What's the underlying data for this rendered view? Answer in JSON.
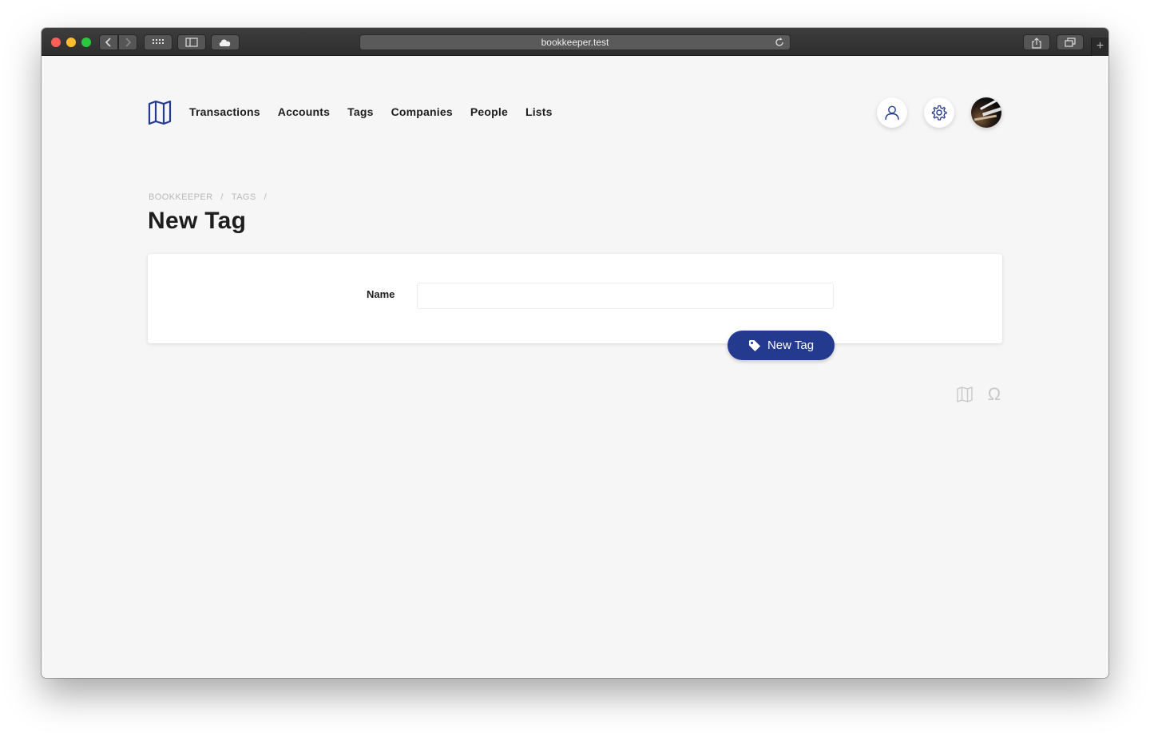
{
  "browser": {
    "url": "bookkeeper.test",
    "icons": [
      "back-icon",
      "forward-icon",
      "grid-icon",
      "sidebar-icon",
      "cloud-icon",
      "reload-icon",
      "share-icon",
      "tabs-icon",
      "plus-icon"
    ],
    "new_tab_glyph": "+"
  },
  "nav": {
    "items": [
      {
        "label": "Transactions"
      },
      {
        "label": "Accounts"
      },
      {
        "label": "Tags"
      },
      {
        "label": "Companies"
      },
      {
        "label": "People"
      },
      {
        "label": "Lists"
      }
    ]
  },
  "header_actions": {
    "icons": [
      "user-icon",
      "gear-icon",
      "avatar"
    ]
  },
  "breadcrumb": {
    "items": [
      {
        "label": "BOOKKEEPER"
      },
      {
        "label": "TAGS"
      }
    ],
    "separator": "/"
  },
  "page": {
    "title": "New Tag"
  },
  "form": {
    "name_label": "Name",
    "name_value": "",
    "submit_label": "New Tag"
  },
  "footer": {
    "omega": "Ω"
  },
  "colors": {
    "accent": "#233a8f",
    "background": "#f6f6f6",
    "card": "#ffffff",
    "text": "#1d1d1d",
    "muted": "#b8b8b8"
  }
}
